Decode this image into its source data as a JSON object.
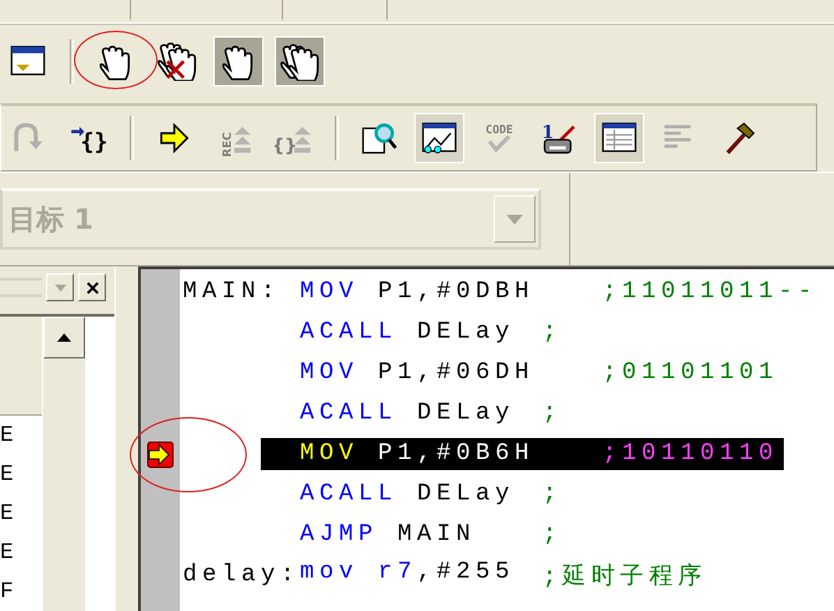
{
  "toolbars": [
    {
      "buttons": [
        {
          "kind": "window",
          "pressed": false,
          "disabled": false,
          "circled": false
        },
        {
          "kind": "separator"
        },
        {
          "kind": "hand",
          "pressed": false,
          "disabled": false,
          "circled": true
        },
        {
          "kind": "hand-crossed",
          "pressed": false,
          "disabled": false,
          "circled": false
        },
        {
          "kind": "hand",
          "pressed": true,
          "disabled": false,
          "circled": false
        },
        {
          "kind": "hands",
          "pressed": true,
          "disabled": false,
          "circled": false
        }
      ]
    },
    {
      "buttons": [
        {
          "kind": "step-over",
          "pressed": false,
          "disabled": true,
          "circled": false
        },
        {
          "kind": "step-out",
          "label": "{}",
          "pressed": false,
          "disabled": false,
          "circled": false
        },
        {
          "kind": "separator"
        },
        {
          "kind": "run-arrow",
          "pressed": false,
          "disabled": false,
          "circled": false
        },
        {
          "kind": "stack",
          "label": "REC",
          "pressed": false,
          "disabled": true,
          "circled": false
        },
        {
          "kind": "stack",
          "label": "{}",
          "pressed": false,
          "disabled": true,
          "circled": false
        },
        {
          "kind": "separator"
        },
        {
          "kind": "magnifier",
          "pressed": false,
          "disabled": false,
          "circled": false
        },
        {
          "kind": "graph",
          "pressed": true,
          "disabled": false,
          "circled": false
        },
        {
          "kind": "check",
          "label": "CODE",
          "pressed": false,
          "disabled": true,
          "circled": false
        },
        {
          "kind": "device",
          "label": "1",
          "pressed": false,
          "disabled": false,
          "circled": false
        },
        {
          "kind": "table",
          "pressed": true,
          "disabled": false,
          "circled": false
        },
        {
          "kind": "lines",
          "pressed": false,
          "disabled": true,
          "circled": false
        },
        {
          "kind": "hammer",
          "pressed": false,
          "disabled": false,
          "circled": false
        }
      ]
    }
  ],
  "target_combo": {
    "value": "目标 1",
    "disabled": true
  },
  "side_panel": {
    "rows": [
      "E",
      "E",
      "E",
      "E",
      "F"
    ]
  },
  "code_lines": [
    {
      "label": "MAIN:",
      "mnemonic": "MOV",
      "operands": [
        {
          "text": "P1,#0DBH",
          "kind": "plain"
        }
      ],
      "comment": ";11011011--",
      "current": false,
      "circled": false
    },
    {
      "mnemonic": "ACALL",
      "operands": [
        {
          "text": "DELay",
          "kind": "plain"
        }
      ],
      "comment": ";",
      "current": false,
      "circled": false
    },
    {
      "mnemonic": "MOV",
      "operands": [
        {
          "text": "P1,#06DH",
          "kind": "plain"
        }
      ],
      "comment": ";01101101",
      "current": false,
      "circled": false
    },
    {
      "mnemonic": "ACALL",
      "operands": [
        {
          "text": "DELay",
          "kind": "plain"
        }
      ],
      "comment": ";",
      "current": false,
      "circled": false
    },
    {
      "mnemonic": "MOV",
      "operands": [
        {
          "text": "P1,#0B6H",
          "kind": "plain"
        }
      ],
      "comment": ";10110110",
      "current": true,
      "circled": true
    },
    {
      "mnemonic": "ACALL",
      "operands": [
        {
          "text": "DELay",
          "kind": "plain"
        }
      ],
      "comment": ";",
      "current": false,
      "circled": false
    },
    {
      "mnemonic": "AJMP",
      "operands": [
        {
          "text": "MAIN",
          "kind": "plain"
        }
      ],
      "comment": ";",
      "current": false,
      "circled": false
    },
    {
      "label": "delay:",
      "mnemonic": "mov",
      "operands": [
        {
          "text": "r7",
          "kind": "register"
        },
        {
          "text": ",#255",
          "kind": "plain"
        }
      ],
      "comment": ";延时子程序",
      "current": false,
      "circled": false
    }
  ]
}
